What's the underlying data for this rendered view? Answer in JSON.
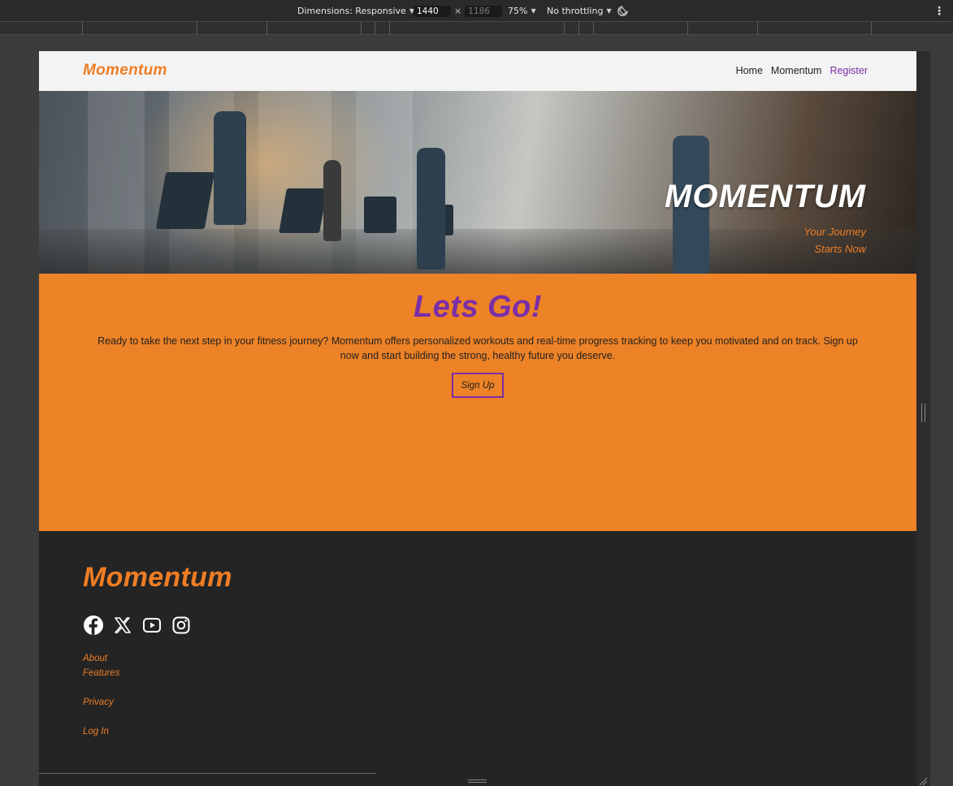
{
  "devtools": {
    "dimensions_label": "Dimensions: Responsive",
    "width_value": "1440",
    "height_value": "1186",
    "times_sign": "×",
    "zoom": "75%",
    "throttling": "No throttling",
    "more_glyph": "⋮"
  },
  "navbar": {
    "brand": "Momentum",
    "links": [
      "Home",
      "Momentum",
      "Register"
    ]
  },
  "hero": {
    "title": "MOMENTUM",
    "subtitle_line1": "Your Journey",
    "subtitle_line2": "Starts Now"
  },
  "cta": {
    "title": "Lets Go!",
    "text": "Ready to take the next step in your fitness journey? Momentum offers personalized workouts and real-time progress tracking to keep you motivated and on track. Sign up now and start building the strong, healthy future you deserve.",
    "button_label": "Sign Up"
  },
  "footer": {
    "brand": "Momentum",
    "socials": [
      "facebook-icon",
      "x-icon",
      "youtube-icon",
      "instagram-icon"
    ],
    "links": [
      "About",
      "Features",
      "Privacy",
      "Log In"
    ]
  },
  "colors": {
    "brand_orange": "#ef7d24",
    "cta_orange": "#ed8226",
    "accent_purple": "#7a2ea8",
    "footer_bg": "#242424",
    "navbar_bg": "#f3f3f3"
  }
}
